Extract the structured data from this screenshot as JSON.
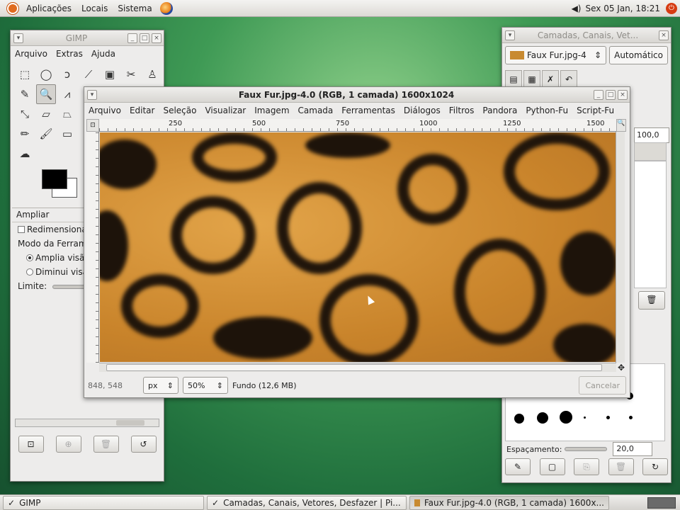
{
  "top_panel": {
    "menu": [
      "Aplicações",
      "Locais",
      "Sistema"
    ],
    "clock": "Sex 05 Jan, 18:21"
  },
  "toolbox": {
    "title": "GIMP",
    "menu": [
      "Arquivo",
      "Extras",
      "Ajuda"
    ],
    "options_header": "Ampliar",
    "opt_resize": "Redimensionar",
    "opt_mode": "Modo da Ferramenta",
    "opt_zoom_in": "Amplia visão",
    "opt_zoom_out": "Diminui visão",
    "opt_limit": "Limite:"
  },
  "image_window": {
    "title": "Faux Fur.jpg-4.0 (RGB, 1 camada) 1600x1024",
    "menu": [
      "Arquivo",
      "Editar",
      "Seleção",
      "Visualizar",
      "Imagem",
      "Camada",
      "Ferramentas",
      "Diálogos",
      "Filtros",
      "Pandora",
      "Python-Fu",
      "Script-Fu"
    ],
    "ruler_ticks": [
      "250",
      "500",
      "750",
      "1000",
      "1250",
      "1500"
    ],
    "coords": "848, 548",
    "unit": "px",
    "zoom": "50%",
    "status": "Fundo (12,6 MB)",
    "cancel": "Cancelar"
  },
  "layers_dock": {
    "title": "Camadas, Canais, Vet...",
    "image_select": "Faux Fur.jpg-4",
    "auto_button": "Automático",
    "opacity": "100,0",
    "spacing_label": "Espaçamento:",
    "spacing_value": "20,0"
  },
  "taskbar": {
    "items": [
      "GIMP",
      "Camadas, Canais, Vetores, Desfazer | Pi...",
      "Faux Fur.jpg-4.0 (RGB, 1 camada) 1600x..."
    ]
  }
}
